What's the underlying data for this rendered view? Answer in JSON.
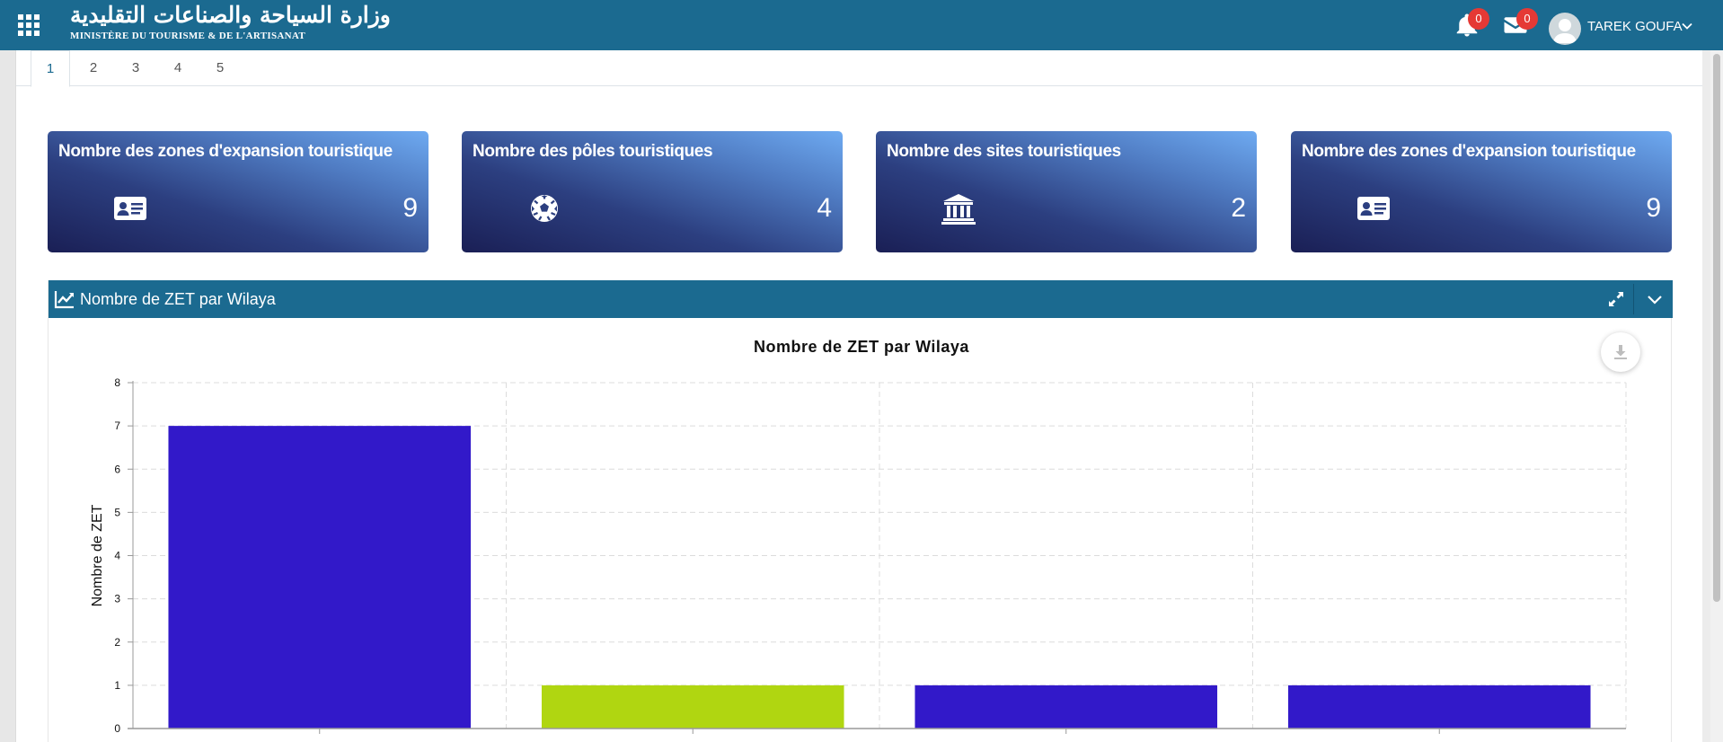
{
  "header": {
    "logo_arabic": "وزارة السياحة والصناعات التقليدية",
    "logo_french": "MINISTÈRE DU TOURISME & DE L'ARTISANAT",
    "notifications_count": "0",
    "messages_count": "0",
    "user_name": "TAREK GOUFA",
    "accent_color": "#1b6a90",
    "badge_color": "#e53935"
  },
  "tabs": [
    "1",
    "2",
    "3",
    "4",
    "5"
  ],
  "active_tab": "1",
  "cards": [
    {
      "title": "Nombre des zones d'expansion touristique",
      "value": "9",
      "icon": "id-card-icon"
    },
    {
      "title": "Nombre des pôles touristiques",
      "value": "4",
      "icon": "soccer-ball-icon"
    },
    {
      "title": "Nombre des sites touristiques",
      "value": "2",
      "icon": "museum-icon"
    },
    {
      "title": "Nombre des zones d'expansion touristique",
      "value": "9",
      "icon": "id-card-icon"
    }
  ],
  "panel": {
    "title": "Nombre de ZET par Wilaya",
    "header_icon": "line-chart-icon",
    "expand_icon": "expand-icon",
    "collapse_icon": "chevron-down-icon"
  },
  "chart_data": {
    "type": "bar",
    "title": "Nombre de ZET par Wilaya",
    "xlabel": "",
    "ylabel": "Nombre de ZET",
    "ylim": [
      0,
      8
    ],
    "yticks": [
      0,
      1,
      2,
      3,
      4,
      5,
      6,
      7,
      8
    ],
    "grid": true,
    "values": [
      7,
      1,
      1,
      1
    ],
    "colors": [
      "#3219c9",
      "#b0d611",
      "#3219c9",
      "#3219c9"
    ]
  }
}
